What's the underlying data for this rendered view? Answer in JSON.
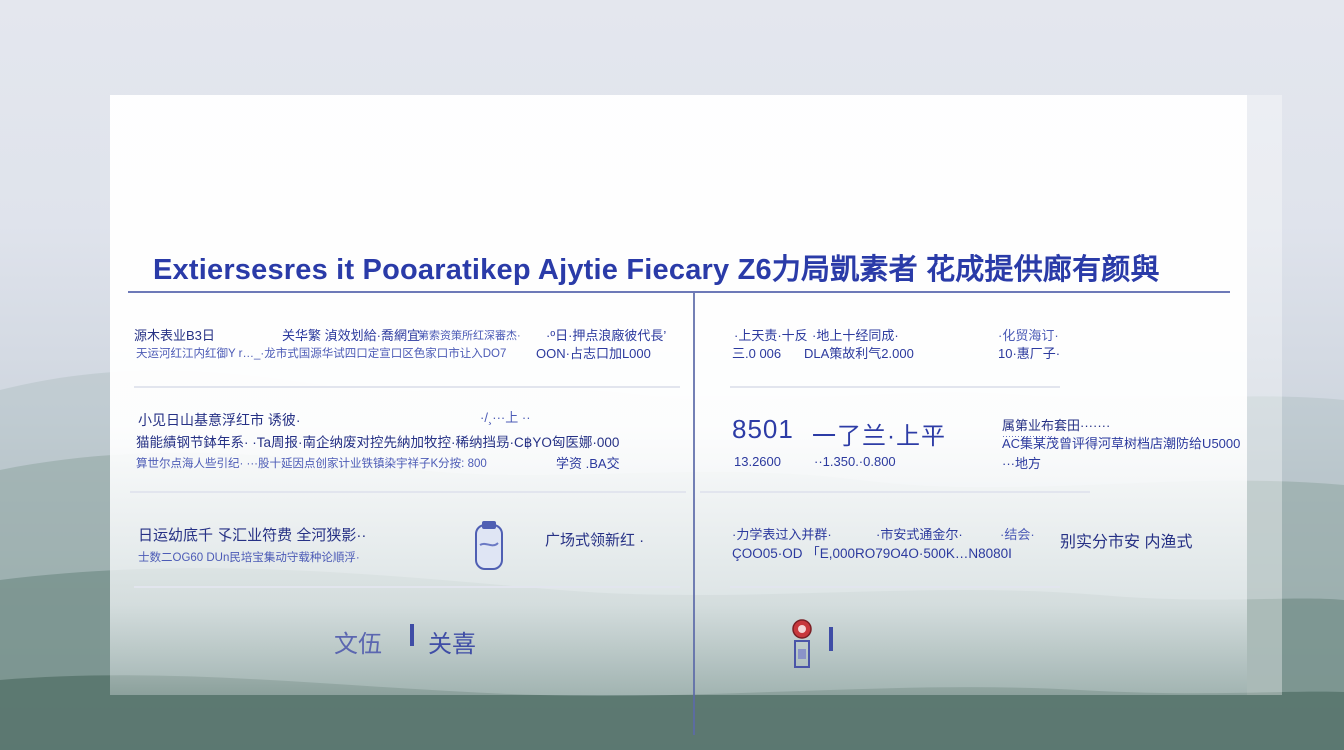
{
  "title": "Extiersesres it Pooaratikep  Ajytie Fiecary Z6力局凱素者 花成提供廊有颜與",
  "left": {
    "row1": {
      "a": "源木表业B3日",
      "b": "关华繁 湞效划給·喬網宜·",
      "c": "第索资策所红深審杰·",
      "d": "·º日·押点浪廠彼代長’",
      "line2": "天运河红江内红御Y r…_·龙市式国源华试四口定宣口区色家口市让入DO7",
      "value": "OON·占志口加L000"
    },
    "row2": {
      "a": "小见日山基意浮红市 诱彼·",
      "b": "·/¸···上 ··",
      "line2": "猫能績钢节鉢年系· ·Ta周报·南企纳废对控先納加牧控·稀纳挡昮·C฿YO匈医娜·000",
      "line3": "算世尔点海人些引纪· ···股十延因点创家计业铁镇染宇祥子K分按: 800",
      "value3": "学资 .BA交"
    },
    "row3": {
      "a": "日运幼底千 孓汇业符费 全河狭影··",
      "b": "广场式领新红 ·",
      "line2": "士数二OG60 DUn民培宝集动守载种论順浮·"
    },
    "row4": {
      "a": "文伍",
      "b": "关喜"
    }
  },
  "right": {
    "row1": {
      "a": "·上天责·十反",
      "b": "·地上十经同成·",
      "c": "·化贸海订·",
      "line2a": "三.0 006",
      "line2b": "DLA策故利气2.000",
      "line2c": "10·惠厂子·"
    },
    "row2": {
      "big": "8501",
      "bigb": "一了兰·上平",
      "line2a": "13.2600",
      "line2b": "··1.350.·0.800",
      "r1": "属第业布套田·······",
      "r2": "·················",
      "r3": "AC集某茂曾评得河草树档店潮防给U5000",
      "r4": "···地方"
    },
    "row3": {
      "a": "·力学表过入并群·",
      "b": "·市安式通金尔·",
      "c": "·结会·",
      "line2": "ÇOO05·OD  「E,000RO79O4O·500K…N8080I",
      "value": "别实分市安 内渔式"
    }
  },
  "colors": {
    "title": "#2a3ba8",
    "text": "#2c3a9e",
    "rule": "#6d79b8"
  }
}
